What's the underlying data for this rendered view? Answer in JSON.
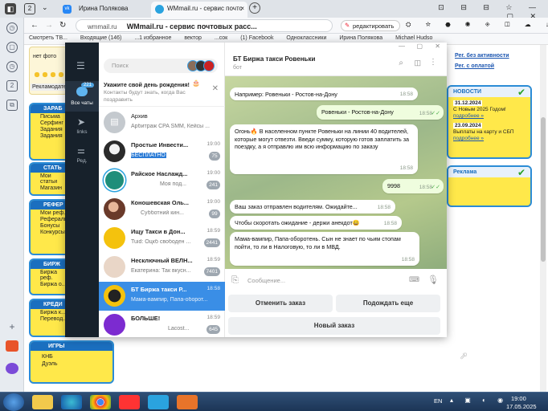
{
  "browser": {
    "tabs": [
      {
        "label": "Ирина Полякова"
      },
      {
        "label": "WMmail.ru - сервис почтс"
      }
    ],
    "tab_count_badge": "2",
    "url_domain": "wmmail.ru",
    "page_title_in_bar": "WMmail.ru - сервис почтовых расс...",
    "edit_button": "редактировать",
    "bookmarks": [
      "Смотреть ТВ...",
      "Входящие (146)",
      "...1 избранное",
      "вектор",
      "...сок",
      "(1) Facebook",
      "Одноклассники",
      "Ирина Полякова",
      "Michael Hudso"
    ]
  },
  "website": {
    "left_labels": [
      "нет фото",
      "Рекламодатель"
    ],
    "sections": [
      {
        "title": "ЗАРАБ",
        "items": [
          "Письма",
          "Серфинг",
          "Задания",
          "Задания"
        ]
      },
      {
        "title": "СТАТЬ",
        "items": [
          "Мои статьи",
          "Магазин"
        ]
      },
      {
        "title": "РЕФЕР",
        "items": [
          "Мои реф.",
          "Реферальн.",
          "Бонусы",
          "Конкурсы"
        ]
      },
      {
        "title": "БИРЖ",
        "items": [
          "Биржа реф.",
          "Биржа о..."
        ]
      },
      {
        "title": "КРЕДИ",
        "items": [
          "Биржа к...",
          "Перевод..."
        ]
      },
      {
        "title": "ИГРЫ",
        "items": [
          "КНБ",
          "Дуэль"
        ]
      }
    ],
    "right_links": [
      "Рег. без активности",
      "Рег. с оплатой"
    ],
    "news": {
      "title": "НОВОСТИ",
      "items": [
        {
          "date": "31.12.2024",
          "text": "С Новым 2025 Годом!",
          "more": "подробнее »"
        },
        {
          "date": "23.09.2024",
          "text": "Выплаты на карту и СБП",
          "more": "подробнее »"
        }
      ]
    },
    "ads_title": "Реклама"
  },
  "telegram": {
    "nav": {
      "all_chats": "Все чаты",
      "unread": "221",
      "links": "links",
      "edit": "Ред."
    },
    "search_placeholder": "Поиск",
    "birthday": {
      "title": "Укажите свой день рождения!",
      "text": "Контакты будут знать, когда Вас поздравить"
    },
    "archive": {
      "title": "Архив",
      "preview": "Арбитраж CPA SMM, Кейсы ..."
    },
    "dialogs": [
      {
        "name": "Простые Инвести...",
        "time": "19:00",
        "preview": "БЕСПЛАТНО С э...",
        "badge": "75"
      },
      {
        "name": "Райское Наслажд...",
        "time": "19:00",
        "preview": "Моя под...",
        "badge": "241"
      },
      {
        "name": "Коношевская Оль...",
        "time": "19:00",
        "preview": "Субботний кин...",
        "badge": "99"
      },
      {
        "name": "Ищу Такси в Дон...",
        "time": "18:59",
        "preview": "Tuid: Оцкб свободен ...",
        "badge": "2441"
      },
      {
        "name": "Несключный ВЕЛН...",
        "time": "18:59",
        "preview": "Екатерина: Так вкусн...",
        "badge": "7401"
      },
      {
        "name": "БТ Биржа такси Р...",
        "time": "18:58",
        "preview": "Мама-вампир, Папа-оборот...",
        "badge": ""
      },
      {
        "name": "БОЛЬШЕ!",
        "time": "18:59",
        "preview": "Lacost...",
        "badge": "645"
      }
    ],
    "chat": {
      "title": "БТ Биржа такси Ровеньки",
      "subtitle": "бот",
      "messages": [
        {
          "text": "Например: Ровеньки - Ростов-на-Дону",
          "time": "18:58",
          "out": false
        },
        {
          "text": "Ровеньки - Ростов-на-Дону",
          "time": "18:58",
          "out": true
        },
        {
          "text": "Огонь🔥 В населенном пункте Ровеньки на линии 40 водителей, которые могут отвезти. Введи сумму, которую готов заплатить за поездку, а я отправлю им всю информацию по заказу",
          "time": "18:58",
          "out": false
        },
        {
          "text": "9998",
          "time": "18:58",
          "out": true
        },
        {
          "text": "Ваш заказ отправлен водителям. Ожидайте...",
          "time": "18:58",
          "out": false
        },
        {
          "text": "Чтобы скоротать ожидание - держи анекдот😀",
          "time": "18:58",
          "out": false
        },
        {
          "text": "Мама-вампир, Папа-оборотень. Сын не знает по чьим стопам пойти, то ли в Налоговую, то ли в МВД.",
          "time": "18:58",
          "out": false
        }
      ],
      "input_placeholder": "Сообщение...",
      "keyboard": [
        "Отменить заказ",
        "Подождать еще",
        "Новый заказ"
      ]
    }
  },
  "taskbar": {
    "lang": "EN",
    "time": "19:00",
    "date": "17.05.2025"
  }
}
